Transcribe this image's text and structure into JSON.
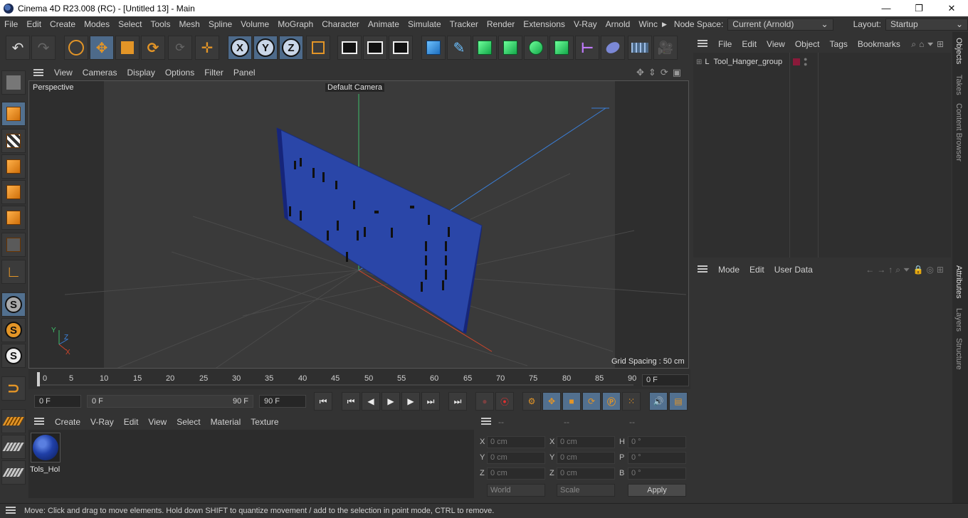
{
  "window": {
    "title": "Cinema 4D R23.008 (RC) - [Untitled 13] - Main",
    "min_glyph": "—",
    "max_glyph": "❐",
    "close_glyph": "✕"
  },
  "menubar": {
    "items": [
      "File",
      "Edit",
      "Create",
      "Modes",
      "Select",
      "Tools",
      "Mesh",
      "Spline",
      "Volume",
      "MoGraph",
      "Character",
      "Animate",
      "Simulate",
      "Tracker",
      "Render",
      "Extensions",
      "V-Ray",
      "Arnold",
      "Winc"
    ],
    "node_space_label": "Node Space:",
    "node_space_value": "Current (Arnold)",
    "layout_label": "Layout:",
    "layout_value": "Startup"
  },
  "toolbar": {
    "axis_x": "X",
    "axis_y": "Y",
    "axis_z": "Z"
  },
  "left_tools": {
    "s1": "S",
    "s2": "S",
    "s3": "S"
  },
  "viewport": {
    "menu": [
      "View",
      "Cameras",
      "Display",
      "Options",
      "Filter",
      "Panel"
    ],
    "projection": "Perspective",
    "camera": "Default Camera",
    "grid_spacing": "Grid Spacing : 50 cm",
    "axis_y": "Y",
    "axis_z": "Z",
    "axis_x": "X"
  },
  "timeline": {
    "ticks": [
      "0",
      "5",
      "10",
      "15",
      "20",
      "25",
      "30",
      "35",
      "40",
      "45",
      "50",
      "55",
      "60",
      "65",
      "70",
      "75",
      "80",
      "85",
      "90"
    ],
    "current_frame": "0 F"
  },
  "transport": {
    "start_frame": "0 F",
    "range_start": "0 F",
    "range_end": "90 F",
    "end_frame": "90 F"
  },
  "materials": {
    "menu": [
      "Create",
      "V-Ray",
      "Edit",
      "View",
      "Select",
      "Material",
      "Texture"
    ],
    "items": [
      {
        "name": "Tols_Hol"
      }
    ]
  },
  "coordinates": {
    "head": [
      "--",
      "--",
      "--"
    ],
    "rows": [
      {
        "a": "X",
        "v1": "0 cm",
        "b": "X",
        "v2": "0 cm",
        "c": "H",
        "v3": "0 °"
      },
      {
        "a": "Y",
        "v1": "0 cm",
        "b": "Y",
        "v2": "0 cm",
        "c": "P",
        "v3": "0 °"
      },
      {
        "a": "Z",
        "v1": "0 cm",
        "b": "Z",
        "v2": "0 cm",
        "c": "B",
        "v3": "0 °"
      }
    ],
    "mode_world": "World",
    "mode_scale": "Scale",
    "apply": "Apply"
  },
  "objects": {
    "menu": [
      "File",
      "Edit",
      "View",
      "Object",
      "Tags",
      "Bookmarks"
    ],
    "items": [
      {
        "name": "Tool_Hanger_group"
      }
    ]
  },
  "attributes": {
    "menu": [
      "Mode",
      "Edit",
      "User Data"
    ]
  },
  "side_tabs": {
    "objects": "Objects",
    "takes": "Takes",
    "content_browser": "Content Browser",
    "attributes": "Attributes",
    "layers": "Layers",
    "structure": "Structure"
  },
  "status": {
    "text": "Move: Click and drag to move elements. Hold down SHIFT to quantize movement / add to the selection in point mode, CTRL to remove."
  },
  "colors": {
    "accent": "#e39527",
    "panel": "#2a46a8",
    "active": "#52708f"
  }
}
